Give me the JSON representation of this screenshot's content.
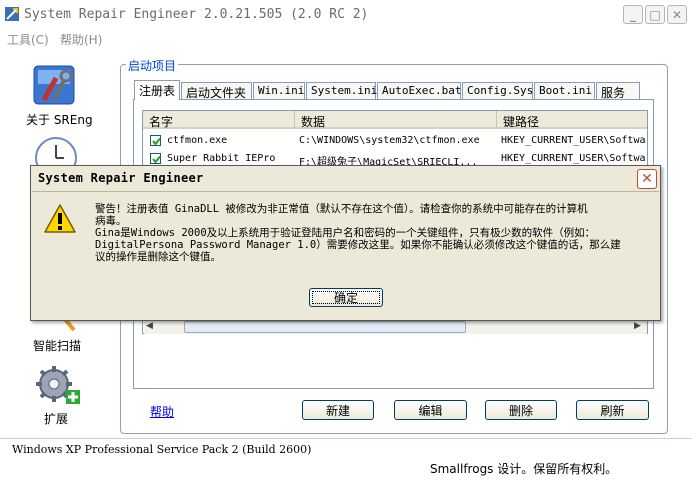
{
  "window": {
    "title": "System Repair Engineer 2.0.21.505 (2.0 RC 2)"
  },
  "menu": [
    {
      "label": "工具(C)"
    },
    {
      "label": "帮助(H)"
    }
  ],
  "nav": [
    {
      "label": "关于 SREng",
      "icon": "toolbox-icon"
    },
    {
      "label": "",
      "icon": "clock-icon"
    },
    {
      "label": "智能扫描",
      "icon": "scan-icon"
    },
    {
      "label": "扩展",
      "icon": "gear-plus-icon"
    }
  ],
  "group": {
    "title": "启动项目"
  },
  "tabs": [
    {
      "label": "注册表"
    },
    {
      "label": "启动文件夹"
    },
    {
      "label": "Win.ini"
    },
    {
      "label": "System.ini"
    },
    {
      "label": "AutoExec.bat"
    },
    {
      "label": "Config.Sys"
    },
    {
      "label": "Boot.ini"
    },
    {
      "label": "服务"
    }
  ],
  "list": {
    "columns": [
      "名字",
      "数据",
      "键路径"
    ],
    "rows": [
      {
        "name": "ctfmon.exe",
        "data": "C:\\WINDOWS\\system32\\ctfmon.exe",
        "path": "HKEY_CURRENT_USER\\Softwar",
        "checked": true
      },
      {
        "name": "Super Rabbit IEPro",
        "data": "F:\\超级兔子\\MagicSet\\SRIECLI...",
        "path": "HKEY_CURRENT_USER\\Softwar",
        "checked": true
      }
    ]
  },
  "buttons": {
    "help": "帮助",
    "new": "新建",
    "edit": "编辑",
    "delete": "删除",
    "refresh": "刷新"
  },
  "status": {
    "os": "Windows XP Professional Service Pack 2 (Build 2600)",
    "copyright": "Smallfrogs 设计。保留所有权利。"
  },
  "dialog": {
    "title": "System Repair Engineer",
    "line1": "警告！注册表值 GinaDLL 被修改为非正常值（默认不存在这个值）。请检查你的系统中可能存在的计算机",
    "line2": "病毒。",
    "line3": "Gina是Windows 2000及以上系统用于验证登陆用户名和密码的一个关键组件，只有极少数的软件（例如：",
    "line4": "DigitalPersona Password Manager 1.0）需要修改这里。如果你不能确认必须修改这个键值的话，那么建",
    "line5": "议的操作是删除这个键值。",
    "ok": "确定"
  }
}
